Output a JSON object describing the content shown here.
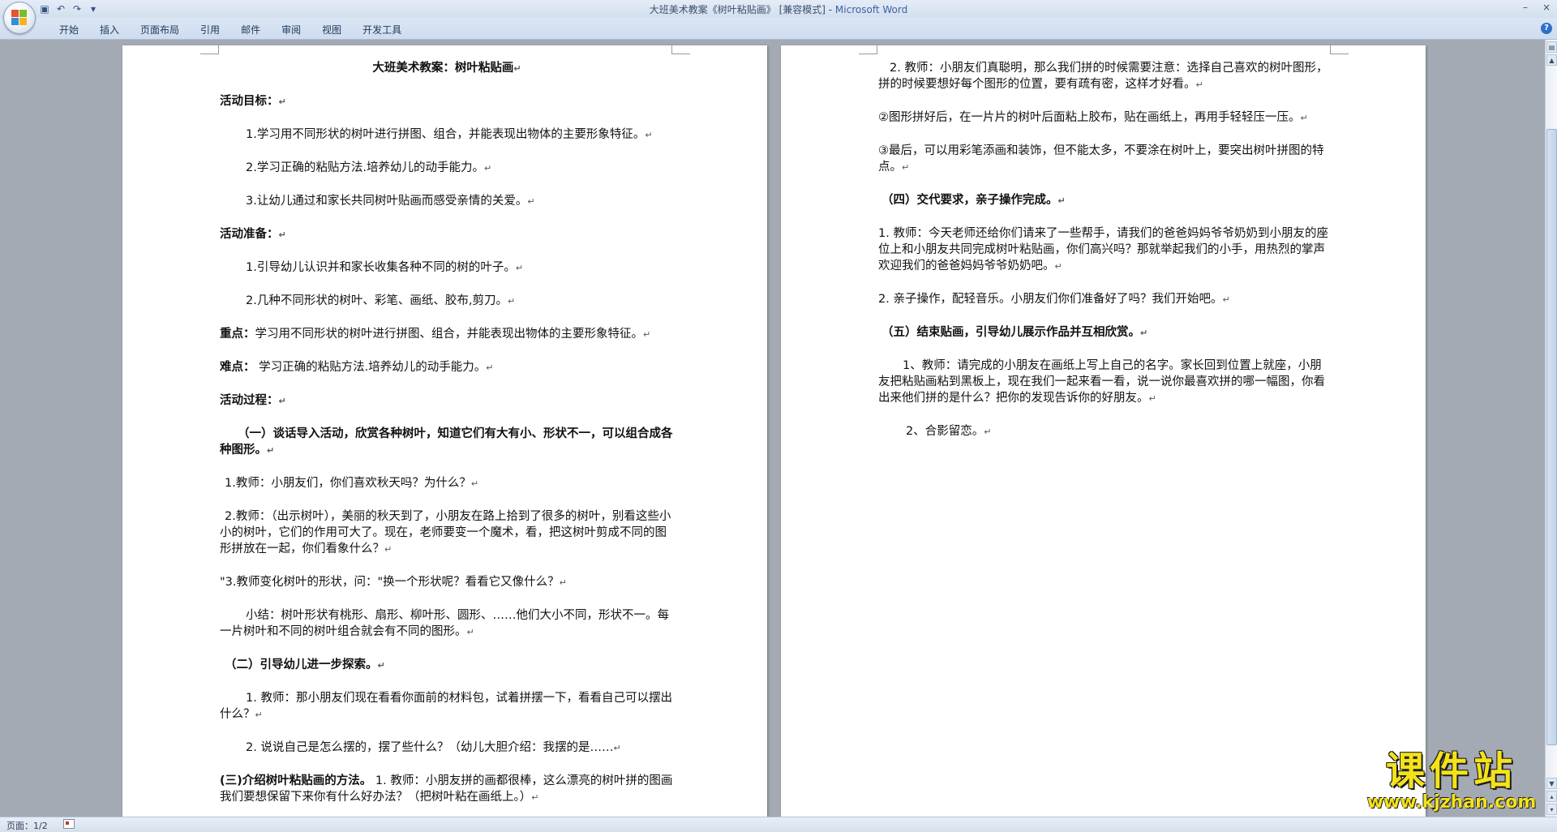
{
  "titlebar": {
    "title": "大班美术教案《树叶粘贴画》 [兼容模式] - ",
    "app_name": "Microsoft Word",
    "minimize": "–",
    "close": "×"
  },
  "ribbon": {
    "tabs": [
      "开始",
      "插入",
      "页面布局",
      "引用",
      "邮件",
      "审阅",
      "视图",
      "开发工具"
    ]
  },
  "page_left": {
    "title": "大班美术教案：树叶粘贴画",
    "goal_heading": "活动目标：",
    "goal_1": "1.学习用不同形状的树叶进行拼图、组合，并能表现出物体的主要形象特征。",
    "goal_2": "2.学习正确的粘贴方法.培养幼儿的动手能力。",
    "goal_3": "3.让幼儿通过和家长共同树叶贴画而感受亲情的关爱。",
    "prep_heading": "活动准备：",
    "prep_1": "1.引导幼儿认识并和家长收集各种不同的树的叶子。",
    "prep_2": "2.几种不同形状的树叶、彩笔、画纸、胶布,剪刀。",
    "key_label": "重点：",
    "key_text": "学习用不同形状的树叶进行拼图、组合，并能表现出物体的主要形象特征。",
    "diff_label": "难点：",
    "diff_text": " 学习正确的粘贴方法.培养幼儿的动手能力。",
    "process_heading": "活动过程：",
    "sec1_heading": "（一）谈话导入活动，欣赏各种树叶，知道它们有大有小、形状不一，可以组合成各种图形。",
    "sec1_1": "1.教师：小朋友们，你们喜欢秋天吗？为什么？",
    "sec1_2": "2.教师：（出示树叶），美丽的秋天到了，小朋友在路上拾到了很多的树叶，别看这些小小的树叶，它们的作用可大了。现在，老师要变一个魔术，看，把这树叶剪成不同的图形拼放在一起，你们看象什么？",
    "sec1_3": "\"3.教师变化树叶的形状，问：\"换一个形状呢？看看它又像什么？",
    "sec1_summary": "小结：树叶形状有桃形、扇形、柳叶形、圆形、……他们大小不同，形状不一。每一片树叶和不同的树叶组合就会有不同的图形。",
    "sec2_heading": "（二）引导幼儿进一步探索。",
    "sec2_1": "1. 教师：那小朋友们现在看看你面前的材料包，试着拼摆一下，看看自己可以摆出什么？",
    "sec2_2": "2. 说说自己是怎么摆的，摆了些什么？（幼儿大胆介绍：我摆的是……",
    "sec3_heading": "(三)介绍树叶粘贴画的方法。",
    "sec3_1": " 1. 教师：小朋友拼的画都很棒，这么漂亮的树叶拼的图画我们要想保留下来你有什么好办法？（把树叶粘在画纸上。）"
  },
  "page_right": {
    "sec3_2": "2. 教师：小朋友们真聪明，那么我们拼的时候需要注意：选择自己喜欢的树叶图形，拼的时候要想好每个图形的位置，要有疏有密，这样才好看。",
    "sec3_3": "②图形拼好后，在一片片的树叶后面粘上胶布，贴在画纸上，再用手轻轻压一压。",
    "sec3_4": "③最后，可以用彩笔添画和装饰，但不能太多，不要涂在树叶上，要突出树叶拼图的特点。",
    "sec4_heading": "（四）交代要求，亲子操作完成。",
    "sec4_1": "1. 教师：今天老师还给你们请来了一些帮手，请我们的爸爸妈妈爷爷奶奶到小朋友的座位上和小朋友共同完成树叶粘贴画，你们高兴吗？那就举起我们的小手，用热烈的掌声欢迎我们的爸爸妈妈爷爷奶奶吧。",
    "sec4_2": "2. 亲子操作，配轻音乐。小朋友们你们准备好了吗？我们开始吧。",
    "sec5_heading": "（五）结束贴画，引导幼儿展示作品并互相欣赏。",
    "sec5_1": "1、教师：请完成的小朋友在画纸上写上自己的名字。家长回到位置上就座，小朋友把粘贴画粘到黑板上，现在我们一起来看一看，说一说你最喜欢拼的哪一幅图，你看出来他们拼的是什么？把你的发现告诉你的好朋友。",
    "sec5_2": "2、合影留恋。"
  },
  "paragraph_mark": "↵",
  "statusbar": {
    "page": "页面：1/2"
  },
  "watermark": {
    "title": "课件站",
    "url": "www.kjzhan.com"
  },
  "icons": [
    "office-button-icon",
    "save-icon",
    "undo-icon",
    "redo-icon",
    "customize-qat-icon",
    "help-icon",
    "proofing-icon"
  ],
  "colors": {
    "accent": "#3a62a8",
    "watermark": "#f4e21a"
  }
}
